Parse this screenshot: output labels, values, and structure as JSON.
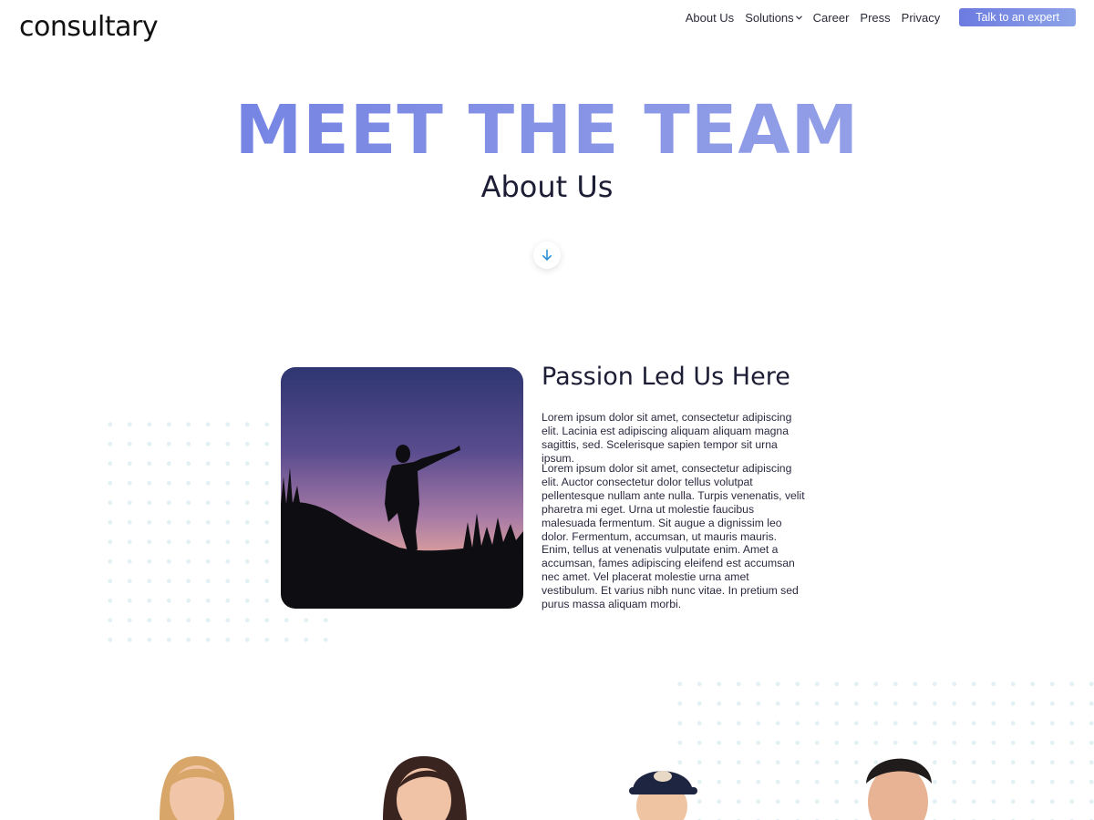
{
  "header": {
    "logo": "consultary",
    "nav": [
      {
        "label": "About Us"
      },
      {
        "label": "Solutions",
        "has_dropdown": true
      },
      {
        "label": "Career"
      },
      {
        "label": "Press"
      },
      {
        "label": "Privacy"
      }
    ],
    "cta_label": "Talk to an expert"
  },
  "hero": {
    "title": "MEET THE TEAM",
    "subtitle": "About Us",
    "scroll_icon": "arrow-down-icon"
  },
  "story": {
    "heading": "Passion Led Us Here",
    "paragraphs": [
      "Lorem ipsum dolor sit amet, consectetur adipiscing elit. Lacinia est adipiscing aliquam aliquam magna sagittis, sed. Scelerisque sapien tempor sit urna ipsum.",
      "Lorem ipsum dolor sit amet, consectetur adipiscing elit. Auctor consectetur dolor tellus volutpat pellentesque nullam ante nulla. Turpis venenatis, velit pharetra mi eget. Urna ut molestie faucibus malesuada fermentum. Sit augue a dignissim leo dolor. Fermentum, accumsan, ut mauris mauris. Enim, tellus at venenatis vulputate enim. Amet a accumsan, fames adipiscing eleifend est accumsan nec amet. Vel placerat molestie urna amet vestibulum. Et varius nibh nunc vitae. In pretium sed purus massa aliquam morbi."
    ]
  },
  "colors": {
    "accent_start": "#6a79e2",
    "accent_end": "#9aa5e8",
    "dots": "#e3f1f4",
    "text_dark": "#1d1d35"
  }
}
